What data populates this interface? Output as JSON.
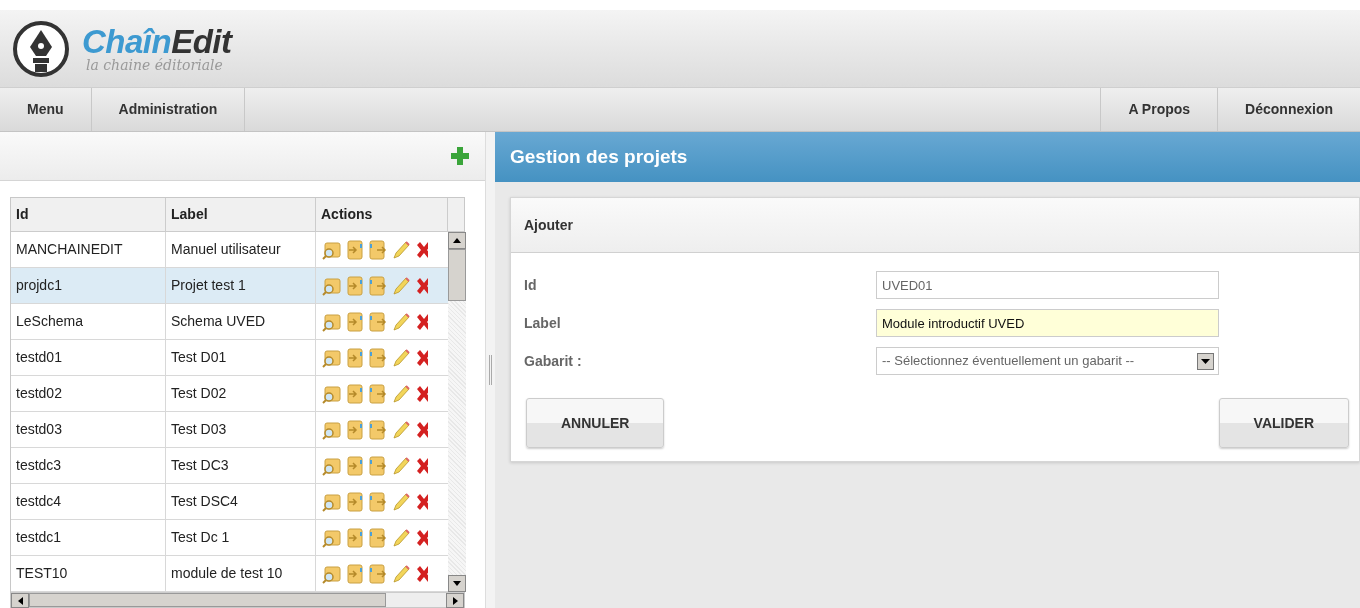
{
  "header": {
    "logo_title_parts": [
      "Chaîn",
      "Edit"
    ],
    "logo_subtitle": "la chaine éditoriale"
  },
  "nav": {
    "left": [
      "Menu",
      "Administration"
    ],
    "right": [
      "A Propos",
      "Déconnexion"
    ]
  },
  "projects": {
    "columns": [
      "Id",
      "Label",
      "Actions"
    ],
    "rows": [
      {
        "id": "MANCHAINEDIT",
        "label": "Manuel utilisateur",
        "selected": false
      },
      {
        "id": "projdc1",
        "label": "Projet test 1",
        "selected": true
      },
      {
        "id": "LeSchema",
        "label": "Schema UVED",
        "selected": false
      },
      {
        "id": "testd01",
        "label": "Test D01",
        "selected": false
      },
      {
        "id": "testd02",
        "label": "Test D02",
        "selected": false
      },
      {
        "id": "testd03",
        "label": "Test D03",
        "selected": false
      },
      {
        "id": "testdc3",
        "label": "Test DC3",
        "selected": false
      },
      {
        "id": "testdc4",
        "label": "Test DSC4",
        "selected": false
      },
      {
        "id": "testdc1",
        "label": "Test Dc 1",
        "selected": false
      },
      {
        "id": "TEST10",
        "label": "module de test 10",
        "selected": false
      }
    ]
  },
  "main": {
    "title": "Gestion des projets",
    "panel_title": "Ajouter",
    "fields": [
      {
        "label": "Id",
        "kind": "text",
        "value": "UVED01",
        "focused": false
      },
      {
        "label": "Label",
        "kind": "text",
        "value": "Module introductif UVED",
        "focused": true
      },
      {
        "label": "Gabarit :",
        "kind": "select",
        "value": "-- Sélectionnez éventuellement un gabarit --"
      }
    ],
    "buttons": [
      "ANNULER",
      "VALIDER"
    ]
  }
}
